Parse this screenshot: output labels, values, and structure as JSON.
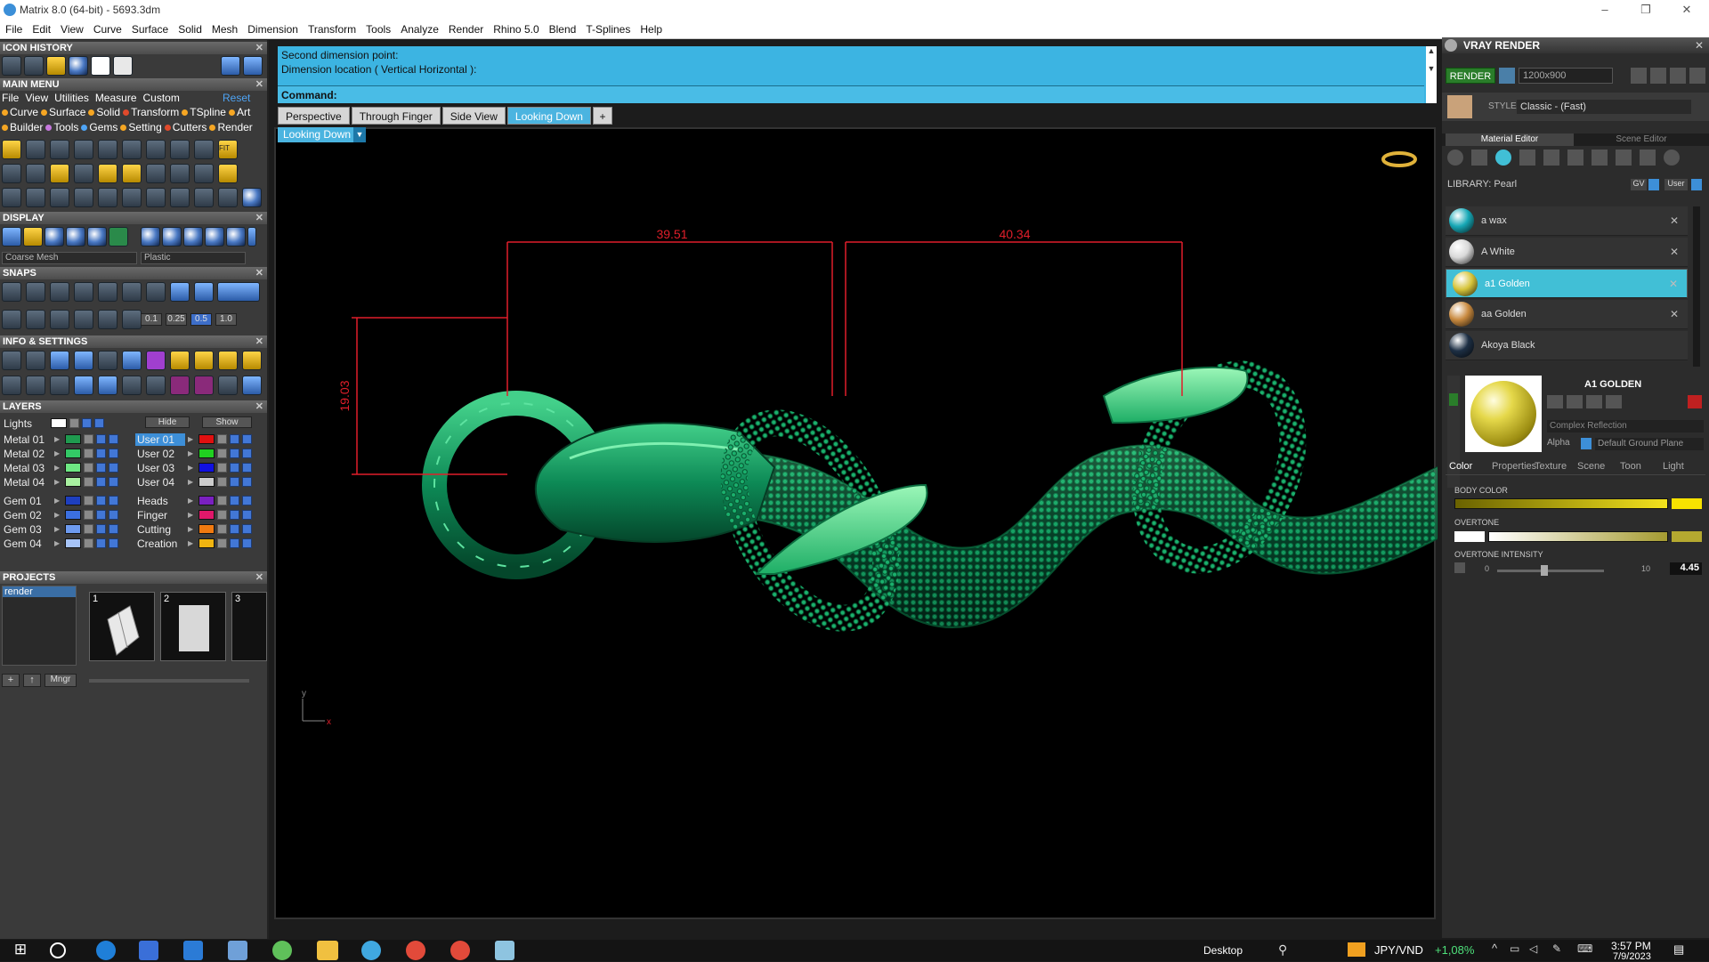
{
  "window": {
    "title": "Matrix 8.0 (64-bit) - 5693.3dm",
    "controls": [
      "–",
      "❐",
      "✕"
    ]
  },
  "menubar": [
    "File",
    "Edit",
    "View",
    "Curve",
    "Surface",
    "Solid",
    "Mesh",
    "Dimension",
    "Transform",
    "Tools",
    "Analyze",
    "Render",
    "Rhino 5.0",
    "Blend",
    "T-Splines",
    "Help"
  ],
  "left": {
    "icon_history": "ICON HISTORY",
    "main_menu": "MAIN MENU",
    "main_menu_items": [
      "File",
      "View",
      "Utilities",
      "Measure",
      "Custom"
    ],
    "reset": "Reset",
    "cat_row1": [
      {
        "label": "Curve",
        "color": "#f5a623"
      },
      {
        "label": "Surface",
        "color": "#f5a623"
      },
      {
        "label": "Solid",
        "color": "#f5a623"
      },
      {
        "label": "Transform",
        "color": "#e04a2c"
      },
      {
        "label": "TSpline",
        "color": "#f5a623"
      },
      {
        "label": "Art",
        "color": "#f5a623"
      }
    ],
    "cat_row2": [
      {
        "label": "Builder",
        "color": "#f5a623"
      },
      {
        "label": "Tools",
        "color": "#c678dd"
      },
      {
        "label": "Gems",
        "color": "#4ea4f5"
      },
      {
        "label": "Setting",
        "color": "#f5a623"
      },
      {
        "label": "Cutters",
        "color": "#e04a2c"
      },
      {
        "label": "Render",
        "color": "#f5a623"
      }
    ],
    "fit_label": "FIT",
    "display": "DISPLAY",
    "display_mesh": "Coarse Mesh",
    "display_material": "Plastic",
    "snaps": "SNAPS",
    "snap_values": [
      "0.1",
      "0.25",
      "0.5",
      "1.0"
    ],
    "info_settings": "INFO & SETTINGS",
    "layers": "LAYERS",
    "lights": "Lights",
    "hide": "Hide",
    "show": "Show",
    "layer_left": [
      {
        "name": "Metal 01",
        "color": "#1f9a4f"
      },
      {
        "name": "Metal 02",
        "color": "#33c966"
      },
      {
        "name": "Metal 03",
        "color": "#6ee883"
      },
      {
        "name": "Metal 04",
        "color": "#a8f0a0"
      },
      {
        "name": "Gem 01",
        "color": "#1e3fbf"
      },
      {
        "name": "Gem 02",
        "color": "#3b6fe0"
      },
      {
        "name": "Gem 03",
        "color": "#6e9bf0"
      },
      {
        "name": "Gem 04",
        "color": "#a7c4f7"
      }
    ],
    "layer_right": [
      {
        "name": "User 01",
        "color": "#e01010"
      },
      {
        "name": "User 02",
        "color": "#20d020"
      },
      {
        "name": "User 03",
        "color": "#1010e0"
      },
      {
        "name": "User 04",
        "color": "#cccccc"
      },
      {
        "name": "Heads",
        "color": "#7a20c0"
      },
      {
        "name": "Finger",
        "color": "#e0186a"
      },
      {
        "name": "Cutting",
        "color": "#f07a10"
      },
      {
        "name": "Creation",
        "color": "#f0b410"
      }
    ],
    "projects": "PROJECTS",
    "project_name": "render",
    "thumb_numbers": [
      "1",
      "2",
      "3"
    ],
    "mngr": "Mngr"
  },
  "command": {
    "line1": "Second dimension point:",
    "line2": "Dimension location ( Vertical  Horizontal ):",
    "prompt": "Command:"
  },
  "view_tabs": [
    "Perspective",
    "Through Finger",
    "Side View",
    "Looking Down"
  ],
  "active_tab": "Looking Down",
  "view_selector": "Looking Down",
  "viewport": {
    "dims": [
      "39.51",
      "40.34",
      "19.03"
    ],
    "axis_y": "y",
    "axis_x": "x"
  },
  "right": {
    "title": "VRAY RENDER",
    "render_btn": "RENDER",
    "resolution": "1200x900",
    "style_label": "STYLE:",
    "style_value": "Classic - (Fast)",
    "tab_material": "Material Editor",
    "tab_scene": "Scene Editor",
    "library": "LIBRARY: Pearl",
    "lib_gv": "GV",
    "lib_user": "User",
    "materials": [
      {
        "name": "a wax",
        "color": "#17a8b6",
        "selected": false
      },
      {
        "name": "A White",
        "color": "#d9d9d9",
        "selected": false
      },
      {
        "name": "a1 Golden",
        "color": "#d6c43a",
        "selected": true
      },
      {
        "name": "aa Golden",
        "color": "#c98a3f",
        "selected": false
      },
      {
        "name": "Akoya Black",
        "color": "#1d2f44",
        "selected": false
      }
    ],
    "preview_name": "A1 GOLDEN",
    "reflection": "Complex Reflection",
    "alpha": "Alpha",
    "ground": "Default Ground Plane",
    "prop_tabs": [
      "Color",
      "Properties",
      "Texture",
      "Scene",
      "Toon",
      "Light"
    ],
    "body_color": "BODY COLOR",
    "overtone": "OVERTONE",
    "overtone_intensity": "OVERTONE INTENSITY",
    "oi_min": "0",
    "oi_max": "10",
    "oi_value": "4.45",
    "oi_fraction": 0.445
  },
  "taskbar": {
    "desktop": "Desktop",
    "ticker": "JPY/VND",
    "change": "+1,08%",
    "time": "3:57 PM",
    "date": "7/9/2023"
  }
}
